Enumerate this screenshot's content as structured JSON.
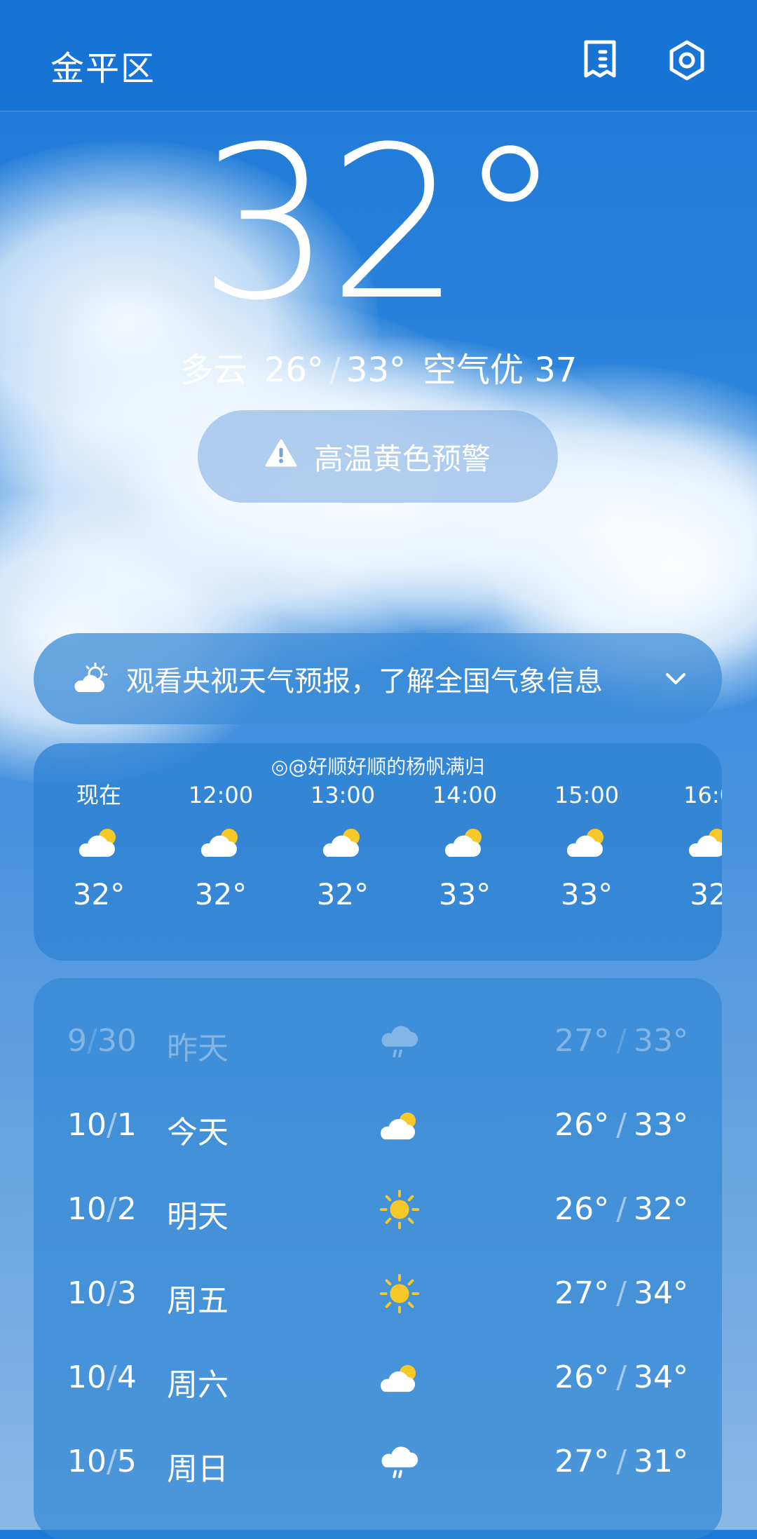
{
  "header": {
    "city": "金平区"
  },
  "current": {
    "temp": "32°",
    "condition": "多云",
    "low": "26°",
    "high": "33°",
    "aqi_label": "空气优 37"
  },
  "alert": {
    "label": "高温黄色预警"
  },
  "promo": {
    "text": "观看央视天气预报，了解全国气象信息"
  },
  "watermark": "@好顺好顺的杨帆满归",
  "hourly": [
    {
      "time": "现在",
      "temp": "32°",
      "icon": "partly-cloudy-icon"
    },
    {
      "time": "12:00",
      "temp": "32°",
      "icon": "partly-cloudy-icon"
    },
    {
      "time": "13:00",
      "temp": "32°",
      "icon": "partly-cloudy-icon"
    },
    {
      "time": "14:00",
      "temp": "33°",
      "icon": "partly-cloudy-icon"
    },
    {
      "time": "15:00",
      "temp": "33°",
      "icon": "partly-cloudy-icon"
    },
    {
      "time": "16:0",
      "temp": "32",
      "icon": "partly-cloudy-icon"
    }
  ],
  "daily": [
    {
      "month": "9",
      "day_num": "30",
      "label": "昨天",
      "low": "27°",
      "high": "33°",
      "icon": "rain-icon"
    },
    {
      "month": "10",
      "day_num": "1",
      "label": "今天",
      "low": "26°",
      "high": "33°",
      "icon": "partly-cloudy-icon"
    },
    {
      "month": "10",
      "day_num": "2",
      "label": "明天",
      "low": "26°",
      "high": "32°",
      "icon": "sun-icon"
    },
    {
      "month": "10",
      "day_num": "3",
      "label": "周五",
      "low": "27°",
      "high": "34°",
      "icon": "sun-icon"
    },
    {
      "month": "10",
      "day_num": "4",
      "label": "周六",
      "low": "26°",
      "high": "34°",
      "icon": "partly-cloudy-icon"
    },
    {
      "month": "10",
      "day_num": "5",
      "label": "周日",
      "low": "27°",
      "high": "31°",
      "icon": "rain-icon"
    }
  ],
  "colors": {
    "header_bg": "#1874d4",
    "sun": "#f7c928",
    "text": "#ffffff"
  }
}
